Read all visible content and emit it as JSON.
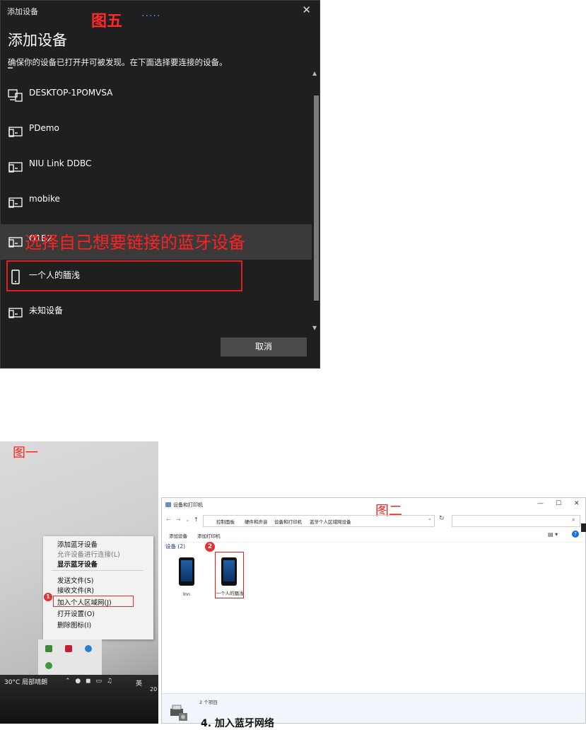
{
  "dialog": {
    "title": "添加设备",
    "close_glyph": "✕",
    "heading": "添加设备",
    "subtitle": "确保你的设备已打开并可被发现。在下面选择要连接的设备。",
    "annotation_top": "图五",
    "annotation_dots": "·····",
    "annotation_mid": "选择自己想要链接的蓝牙设备",
    "devices": [
      {
        "label": "DESKTOP-1POMVSA",
        "icon": "computer-icon"
      },
      {
        "label": "PDemo",
        "icon": "monitor-icon"
      },
      {
        "label": "NIU Link DDBC",
        "icon": "monitor-icon"
      },
      {
        "label": "mobike",
        "icon": "monitor-icon"
      },
      {
        "label": "Q1B2",
        "icon": "monitor-icon"
      },
      {
        "label": "一个人的腼浅",
        "icon": "phone-icon"
      },
      {
        "label": "未知设备",
        "icon": "monitor-icon"
      }
    ],
    "cancel_label": "取消"
  },
  "photo": {
    "annotation": "图一",
    "menu": [
      {
        "label": "添加蓝牙设备",
        "style": "normal"
      },
      {
        "label": "允许设备进行连接(L)",
        "style": "gray"
      },
      {
        "label": "显示蓝牙设备",
        "style": "bold"
      },
      {
        "label": "发送文件(S)",
        "style": "normal"
      },
      {
        "label": "接收文件(R)",
        "style": "normal"
      },
      {
        "label": "加入个人区域网(J)",
        "style": "normal"
      },
      {
        "label": "打开设置(O)",
        "style": "normal"
      },
      {
        "label": "删除图标(I)",
        "style": "normal"
      }
    ],
    "marker": "1",
    "taskbar_temp": "30°C 局部晴朗",
    "taskbar_ime": "英",
    "taskbar_year": "20"
  },
  "explorer": {
    "title": "设备和打印机",
    "annotation": "图二",
    "breadcrumbs": [
      "控制面板",
      "硬件和声音",
      "设备和打印机",
      "蓝牙个人区域网设备"
    ],
    "toolbar": {
      "add_device": "添加设备",
      "add_printer": "添加打印机"
    },
    "group_header": "设备 (2)",
    "devices": [
      {
        "label": "lnn"
      },
      {
        "label": "一个人的腼浅"
      }
    ],
    "marker": "2",
    "status": "2 个项目"
  },
  "peek_text": "4. 加入蓝牙网络"
}
